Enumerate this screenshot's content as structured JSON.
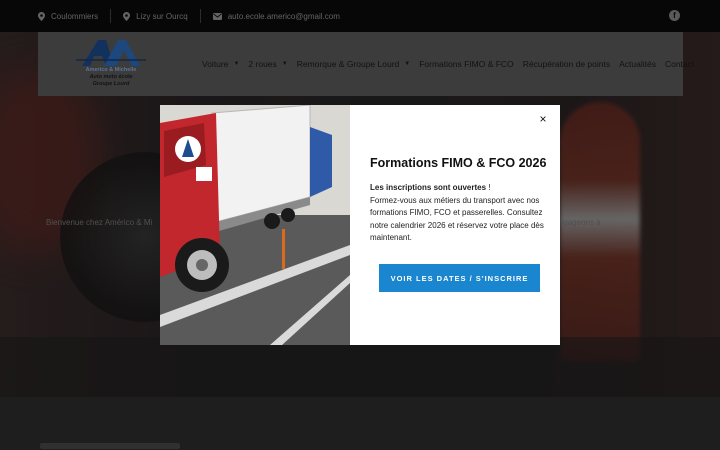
{
  "topbar": {
    "location1": "Coulommiers",
    "location2": "Lizy sur Ourcq",
    "email": "auto.ecole.americo@gmail.com"
  },
  "logo": {
    "line1": "Americo & Michelle",
    "line2": "Auto moto école",
    "line3": "Groupe Lourd"
  },
  "nav": [
    {
      "label": "Voiture",
      "dropdown": true
    },
    {
      "label": "2 roues",
      "dropdown": true
    },
    {
      "label": "Remorque & Groupe Lourd",
      "dropdown": true
    },
    {
      "label": "Formations FIMO & FCO",
      "dropdown": false
    },
    {
      "label": "Récupération de points",
      "dropdown": false
    },
    {
      "label": "Actualités",
      "dropdown": false
    },
    {
      "label": "Contact",
      "dropdown": false
    }
  ],
  "hero": {
    "text_left": "Bienvenue chez Américo & Mi",
    "text_right": "30 ans, nous nous engageons à"
  },
  "modal": {
    "title": "Formations FIMO & FCO 2026",
    "intro_bold": "Les inscriptions sont ouvertes",
    "intro_rest": " !",
    "body": "Formez-vous aux métiers du transport avec nos formations FIMO, FCO et passerelles. Consultez notre calendrier 2026 et réservez votre place dès maintenant.",
    "cta": "VOIR LES DATES / S'INSCRIRE",
    "close": "×"
  },
  "colors": {
    "accent": "#1a86d0",
    "header_bg": "#5c5c5c",
    "topbar_bg": "#0c0c0c"
  },
  "icons": {
    "topbar": [
      "map-marker-icon",
      "map-marker-icon",
      "envelope-icon",
      "facebook-icon"
    ]
  }
}
